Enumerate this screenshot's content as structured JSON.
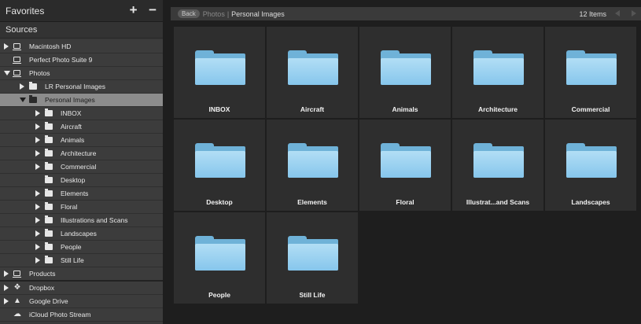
{
  "sidebar": {
    "favorites_title": "Favorites",
    "add_symbol": "+",
    "remove_symbol": "−",
    "sources_title": "Sources",
    "tree": [
      {
        "label": "Macintosh HD",
        "expand": "right",
        "icon": "drive"
      },
      {
        "label": "Perfect Photo Suite 9",
        "expand": "",
        "icon": "drive"
      },
      {
        "label": "Photos",
        "expand": "down",
        "icon": "drive"
      },
      {
        "label": "LR Personal Images",
        "expand": "right",
        "icon": "folder"
      },
      {
        "label": "Personal Images",
        "expand": "down",
        "icon": "folder",
        "selected": true
      },
      {
        "label": "INBOX",
        "expand": "right",
        "icon": "folder"
      },
      {
        "label": "Aircraft",
        "expand": "right",
        "icon": "folder"
      },
      {
        "label": "Animals",
        "expand": "right",
        "icon": "folder"
      },
      {
        "label": "Architecture",
        "expand": "right",
        "icon": "folder"
      },
      {
        "label": "Commercial",
        "expand": "right",
        "icon": "folder"
      },
      {
        "label": "Desktop",
        "expand": "",
        "icon": "folder"
      },
      {
        "label": "Elements",
        "expand": "right",
        "icon": "folder"
      },
      {
        "label": "Floral",
        "expand": "right",
        "icon": "folder"
      },
      {
        "label": "Illustrations and Scans",
        "expand": "right",
        "icon": "folder"
      },
      {
        "label": "Landscapes",
        "expand": "right",
        "icon": "folder"
      },
      {
        "label": "People",
        "expand": "right",
        "icon": "folder"
      },
      {
        "label": "Still Life",
        "expand": "right",
        "icon": "folder"
      },
      {
        "label": "Products",
        "expand": "right",
        "icon": "drive"
      },
      {
        "label": "Dropbox",
        "expand": "right",
        "icon": "dropbox"
      },
      {
        "label": "Google Drive",
        "expand": "right",
        "icon": "google-drive"
      },
      {
        "label": "iCloud Photo Stream",
        "expand": "",
        "icon": "cloud"
      }
    ]
  },
  "topbar": {
    "back_label": "Back",
    "crumb_parent": "Photos",
    "crumb_separator": "|",
    "crumb_current": "Personal Images",
    "item_count": "12 Items"
  },
  "grid": {
    "folder_color": "#86c6ec",
    "items": [
      {
        "label": "INBOX"
      },
      {
        "label": "Aircraft"
      },
      {
        "label": "Animals"
      },
      {
        "label": "Architecture"
      },
      {
        "label": "Commercial"
      },
      {
        "label": "Desktop"
      },
      {
        "label": "Elements"
      },
      {
        "label": "Floral"
      },
      {
        "label": "Illustrat...and Scans"
      },
      {
        "label": "Landscapes"
      },
      {
        "label": "People"
      },
      {
        "label": "Still Life"
      }
    ]
  }
}
